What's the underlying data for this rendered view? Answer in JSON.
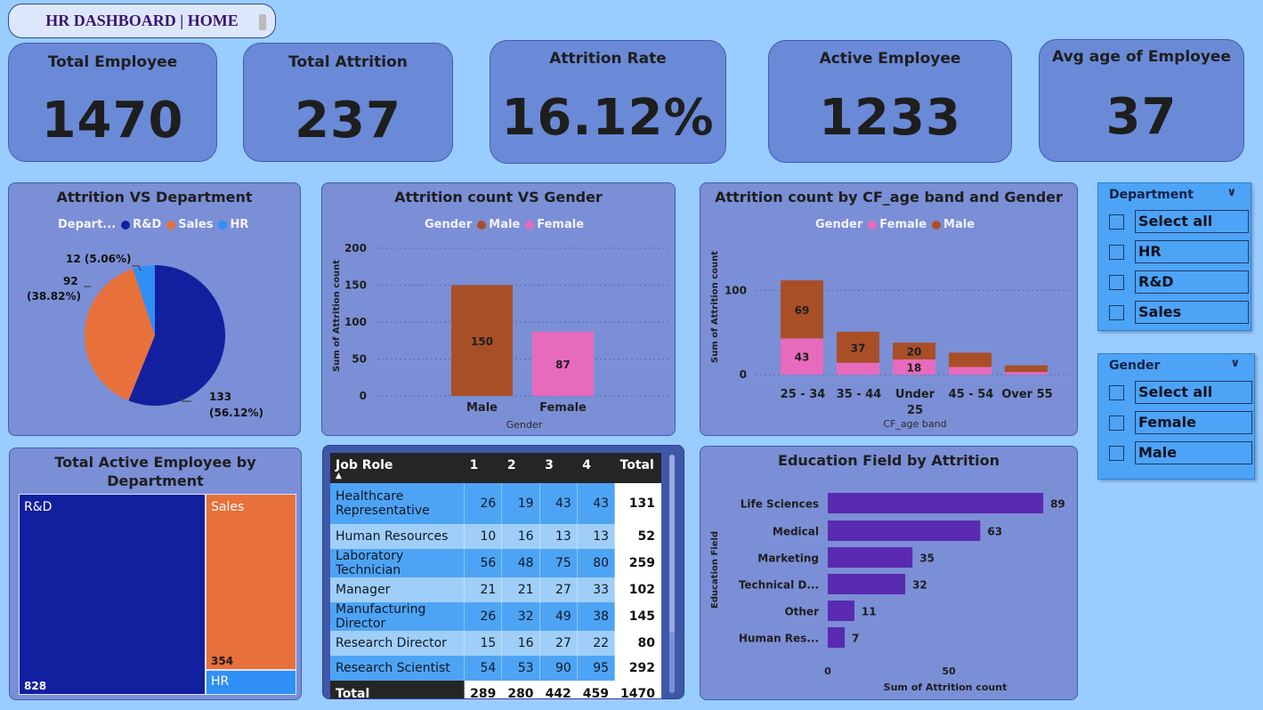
{
  "header": {
    "home_label": "HR DASHBOARD | HOME"
  },
  "kpis": [
    {
      "title": "Total Employee",
      "value": "1470"
    },
    {
      "title": "Total Attrition",
      "value": "237"
    },
    {
      "title": "Attrition Rate",
      "value": "16.12%"
    },
    {
      "title": "Active Employee",
      "value": "1233"
    },
    {
      "title": "Avg age of Employee",
      "value": "37"
    }
  ],
  "charts": {
    "dept_pie": {
      "title": "Attrition VS Department",
      "legend_title": "Depart...",
      "labels": {
        "hr": "12 (5.06%)",
        "sales_a": "92",
        "sales_b": "(38.82%)",
        "rd_a": "133",
        "rd_b": "(56.12%)"
      }
    },
    "gender_bar": {
      "title": "Attrition count VS Gender",
      "legend_title": "Gender",
      "ylabel": "Sum of Attrition count",
      "xlabel": "Gender",
      "ticks": [
        "200",
        "150",
        "100",
        "50",
        "0"
      ]
    },
    "age_bar": {
      "title": "Attrition count by CF_age band and Gender",
      "legend_title": "Gender",
      "ylabel": "Sum of Attrition count",
      "xlabel": "CF_age band",
      "ticks": [
        "100",
        "0"
      ],
      "cat_labels": [
        "25 - 34",
        "35 - 44",
        "Under",
        "25",
        "45 - 54",
        "Over 55"
      ]
    },
    "treemap": {
      "title_a": "Total Active Employee by",
      "title_b": "Department"
    },
    "edu_bar": {
      "title": "Education Field by Attrition",
      "ylabel": "Education Field",
      "xlabel": "Sum of Attrition count",
      "ticks": [
        "0",
        "50"
      ]
    }
  },
  "chart_data": [
    {
      "type": "pie",
      "title": "Attrition VS Department",
      "categories": [
        "R&D",
        "Sales",
        "HR"
      ],
      "values": [
        133,
        92,
        12
      ],
      "colors": [
        "#1220a0",
        "#e8703a",
        "#2f8ff5"
      ]
    },
    {
      "type": "bar",
      "title": "Attrition count VS Gender",
      "categories": [
        "Male",
        "Female"
      ],
      "values": [
        150,
        87
      ],
      "colors": [
        "#a94f28",
        "#e86abd"
      ],
      "xlabel": "Gender",
      "ylabel": "Sum of Attrition count",
      "ylim": [
        0,
        200
      ]
    },
    {
      "type": "bar",
      "title": "Attrition count by CF_age band and Gender",
      "categories": [
        "25 - 34",
        "35 - 44",
        "Under 25",
        "45 - 54",
        "Over 55"
      ],
      "series": [
        {
          "name": "Female",
          "values": [
            43,
            14,
            18,
            9,
            3
          ],
          "color": "#e86abd"
        },
        {
          "name": "Male",
          "values": [
            69,
            37,
            20,
            17,
            8
          ],
          "color": "#a94f28"
        }
      ],
      "shown_labels": {
        "female": [
          "43",
          "",
          "18",
          "",
          ""
        ],
        "male": [
          "69",
          "37",
          "20",
          "",
          ""
        ]
      },
      "xlabel": "CF_age band",
      "ylabel": "Sum of Attrition count",
      "ylim": [
        0,
        120
      ]
    },
    {
      "type": "treemap",
      "title": "Total Active Employee by Department",
      "categories": [
        "R&D",
        "Sales",
        "HR"
      ],
      "values": [
        828,
        354,
        51
      ],
      "value_labels": [
        "828",
        "354",
        ""
      ],
      "colors": [
        "#1220a0",
        "#e8703a",
        "#2f8ff5"
      ]
    },
    {
      "type": "bar",
      "title": "Education Field by Attrition",
      "orientation": "horizontal",
      "categories": [
        "Life Sciences",
        "Medical",
        "Marketing",
        "Technical D...",
        "Other",
        "Human Res..."
      ],
      "values": [
        89,
        63,
        35,
        32,
        11,
        7
      ],
      "color": "#5a2ab0",
      "xlabel": "Sum of Attrition count",
      "ylabel": "Education Field",
      "xlim": [
        0,
        92
      ]
    }
  ],
  "table": {
    "headers": [
      "Job Role",
      "1",
      "2",
      "3",
      "4",
      "Total"
    ],
    "rows": [
      [
        "Healthcare Representative",
        "26",
        "19",
        "43",
        "43",
        "131"
      ],
      [
        "Human Resources",
        "10",
        "16",
        "13",
        "13",
        "52"
      ],
      [
        "Laboratory Technician",
        "56",
        "48",
        "75",
        "80",
        "259"
      ],
      [
        "Manager",
        "21",
        "21",
        "27",
        "33",
        "102"
      ],
      [
        "Manufacturing Director",
        "26",
        "32",
        "49",
        "38",
        "145"
      ],
      [
        "Research Director",
        "15",
        "16",
        "27",
        "22",
        "80"
      ],
      [
        "Research Scientist",
        "54",
        "53",
        "90",
        "95",
        "292"
      ]
    ],
    "total": [
      "Total",
      "289",
      "280",
      "442",
      "459",
      "1470"
    ]
  },
  "slicers": {
    "department": {
      "title": "Department",
      "items": [
        "Select all",
        "HR",
        "R&D",
        "Sales"
      ]
    },
    "gender": {
      "title": "Gender",
      "items": [
        "Select all",
        "Female",
        "Male"
      ]
    }
  }
}
